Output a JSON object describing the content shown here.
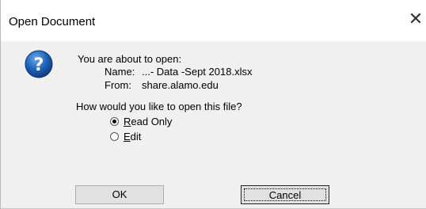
{
  "window": {
    "title": "Open Document",
    "close_glyph": "✕"
  },
  "message": {
    "intro": "You are about to open:",
    "name_label": "Name:",
    "name_value": "...- Data -Sept 2018.xlsx",
    "from_label": "From:",
    "from_value": "share.alamo.edu",
    "question": "How would you like to open this file?"
  },
  "options": [
    {
      "accel": "R",
      "rest": "ead Only",
      "selected": true
    },
    {
      "accel": "E",
      "rest": "dit",
      "selected": false
    }
  ],
  "buttons": {
    "ok": "OK",
    "cancel": "Cancel"
  },
  "icon": {
    "name": "help-question-icon",
    "color": "#1c5fb5"
  }
}
